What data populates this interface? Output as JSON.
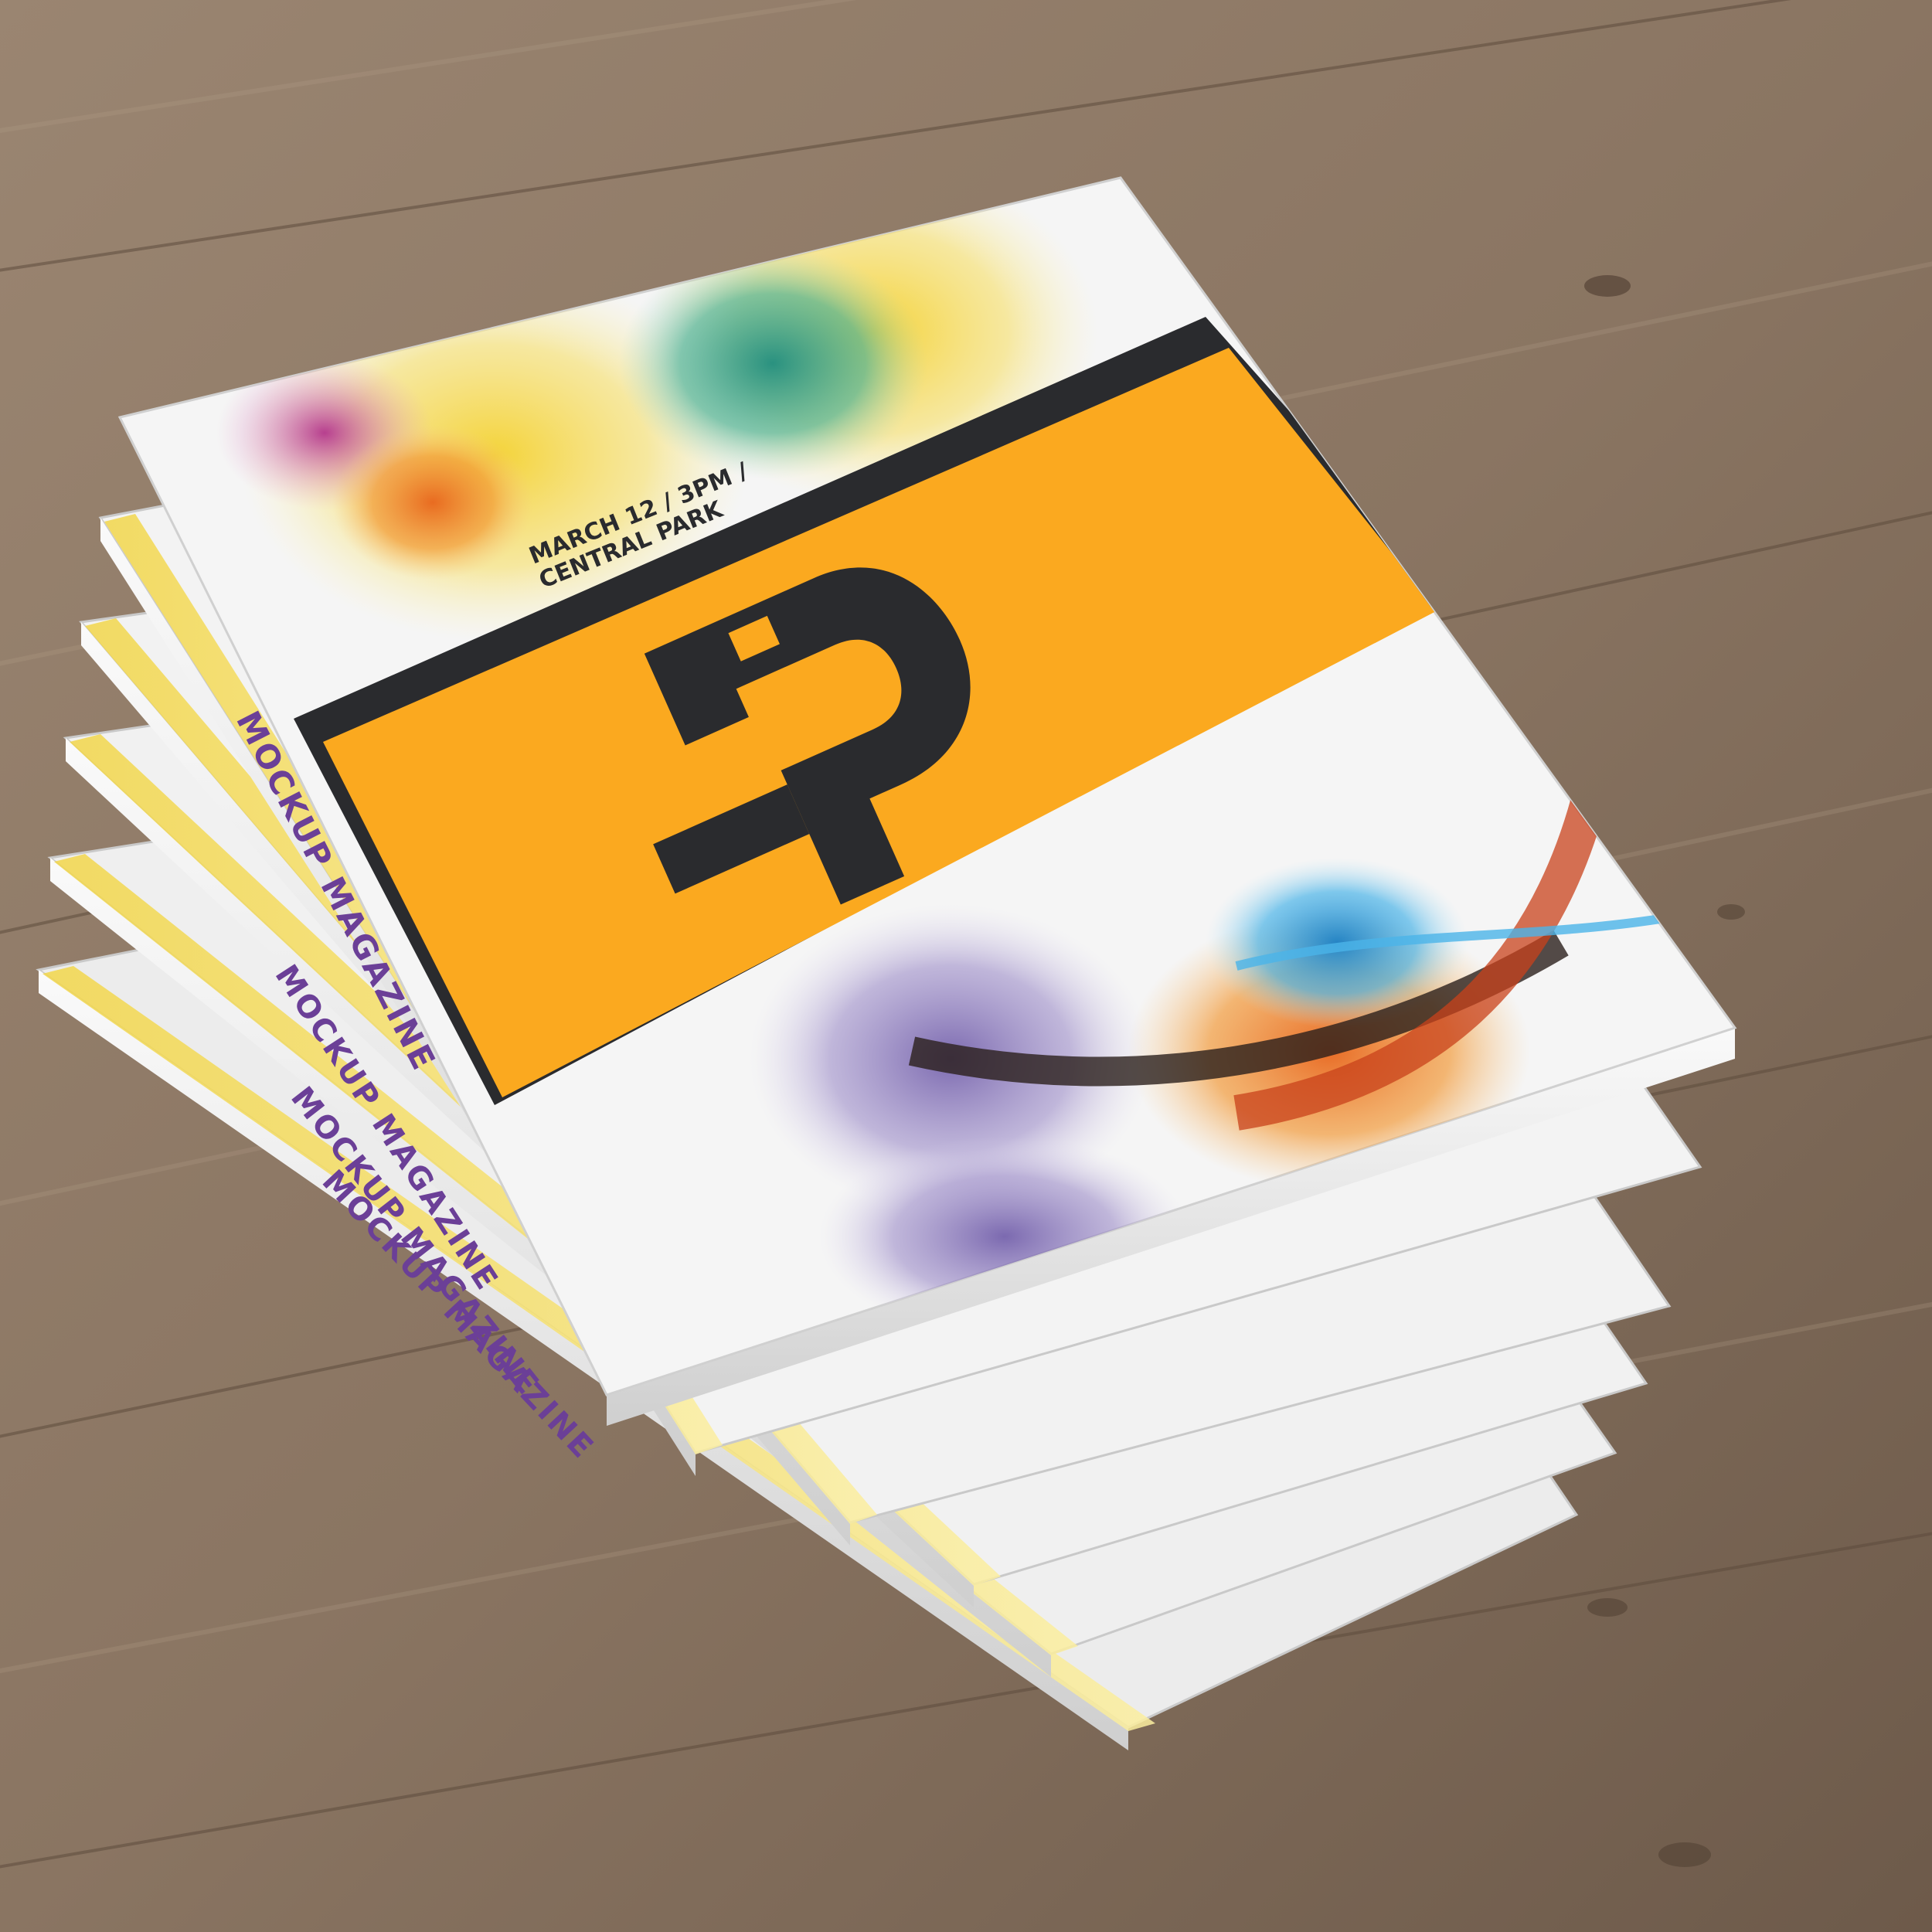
{
  "cover": {
    "event_line1": "MARCH 12  / 3PM /",
    "event_line2": "CENTRAL PARK"
  },
  "spine": {
    "label": "MOCKUP MAGAZINE"
  },
  "logo": {
    "icon": "stylized-p-monogram-icon"
  },
  "colors": {
    "band_orange": "#fba91f",
    "band_dark": "#2a2b2e",
    "wood_light": "#a08c76",
    "wood_dark": "#6e5a49",
    "spine_yellow": "#f7e36a",
    "spine_text_purple": "#6b3f97",
    "paper_white": "#f4f4f4",
    "paper_edge": "#d9d9d9"
  }
}
